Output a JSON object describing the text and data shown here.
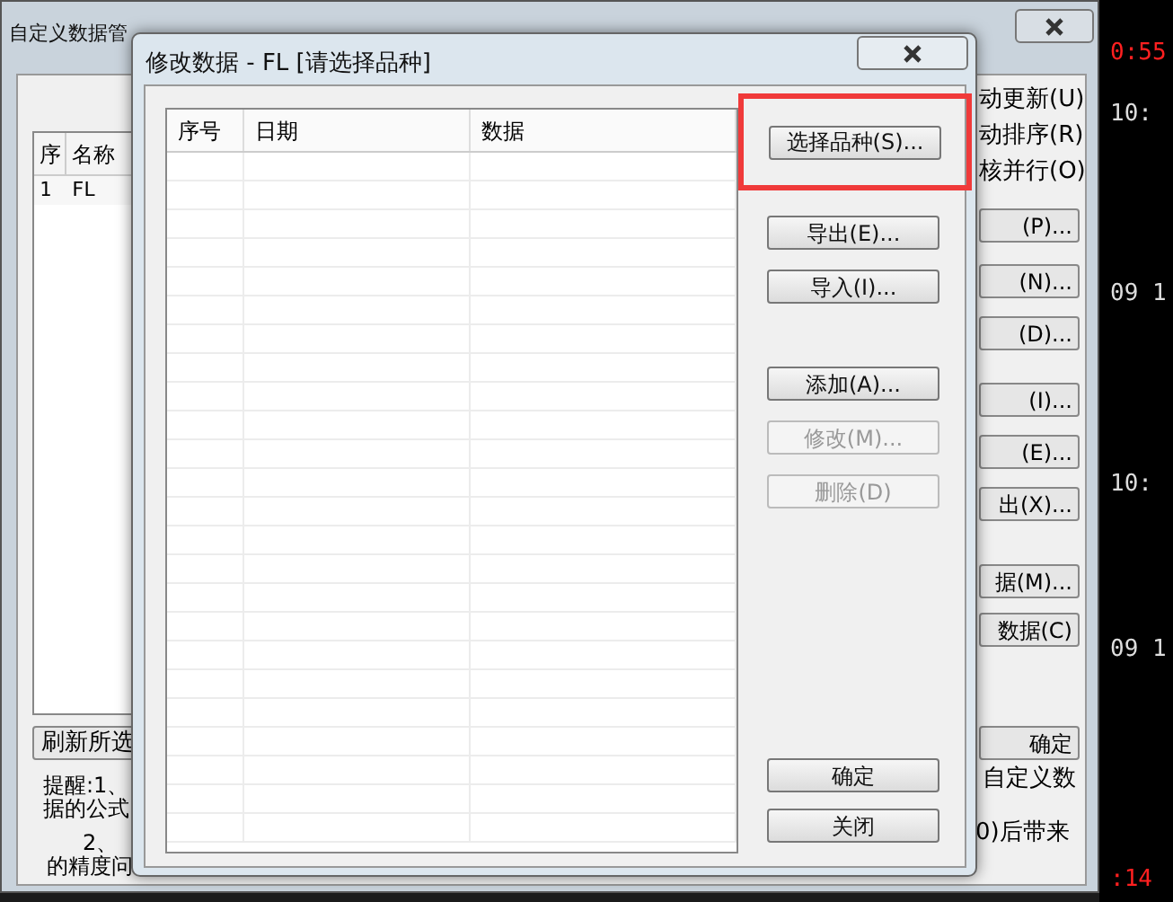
{
  "background_window": {
    "title": "自定义数据管",
    "list": {
      "columns": [
        "序",
        "名称"
      ],
      "rows": [
        [
          "1",
          "FL"
        ]
      ]
    },
    "options": [
      {
        "label": "动更新(U)"
      },
      {
        "label": "动排序(R)"
      },
      {
        "label": "核并行(O)"
      }
    ],
    "buttons": [
      "(P)...",
      "(N)...",
      "(D)...",
      "(I)...",
      "(E)...",
      "出(X)...",
      "据(M)...",
      "数据(C)",
      "确定"
    ],
    "refresh_button": "刷新所选",
    "notes": [
      "提醒:1、",
      "据的公式",
      "2、",
      "的精度问"
    ],
    "side_texts": [
      "自定义数",
      "0)后带来"
    ]
  },
  "dialog": {
    "title": "修改数据 - FL [请选择品种]",
    "table": {
      "columns": [
        "序号",
        "日期",
        "数据"
      ]
    },
    "buttons": [
      {
        "label": "选择品种(S)...",
        "disabled": false,
        "highlighted": true
      },
      {
        "label": "导出(E)...",
        "disabled": false,
        "highlighted": false
      },
      {
        "label": "导入(I)...",
        "disabled": false,
        "highlighted": false
      },
      {
        "label": "添加(A)...",
        "disabled": false,
        "highlighted": false
      },
      {
        "label": "修改(M)...",
        "disabled": true,
        "highlighted": false
      },
      {
        "label": "删除(D)",
        "disabled": true,
        "highlighted": false
      },
      {
        "label": "确定",
        "disabled": false,
        "highlighted": false
      },
      {
        "label": "关闭",
        "disabled": false,
        "highlighted": false
      }
    ]
  },
  "side_app": {
    "readings": [
      {
        "text": "0:55",
        "kind": "alert"
      },
      {
        "text": "10:",
        "kind": "plain"
      },
      {
        "text": "09 1",
        "kind": "plain"
      },
      {
        "text": "10:",
        "kind": "plain"
      },
      {
        "text": "09 1",
        "kind": "plain"
      },
      {
        "text": ":14",
        "kind": "alert"
      }
    ]
  }
}
